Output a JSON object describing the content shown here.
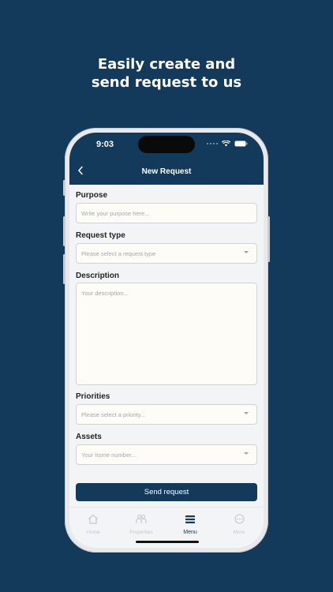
{
  "headline": {
    "line1": "Easily create and",
    "line2": "send request to us"
  },
  "status": {
    "time": "9:03"
  },
  "header": {
    "title": "New Request",
    "back_glyph": "<"
  },
  "form": {
    "purpose": {
      "label": "Purpose",
      "placeholder": "Write your purpose here..."
    },
    "request_type": {
      "label": "Request type",
      "placeholder": "Please select a request type"
    },
    "description": {
      "label": "Description",
      "placeholder": "Your description..."
    },
    "priorities": {
      "label": "Priorities",
      "placeholder": "Please select a priority..."
    },
    "assets": {
      "label": "Assets",
      "placeholder": "Your home number..."
    }
  },
  "send_button": {
    "label": "Send request"
  },
  "tabs": [
    {
      "label": "Home",
      "icon": "home-icon"
    },
    {
      "label": "Properties",
      "icon": "properties-icon"
    },
    {
      "label": "Menu",
      "icon": "menu-icon",
      "active": true
    },
    {
      "label": "More",
      "icon": "more-icon"
    }
  ],
  "colors": {
    "brand": "#133a5a",
    "field_bg": "#fdfcf6",
    "screen_bg": "#f3f4f6"
  }
}
